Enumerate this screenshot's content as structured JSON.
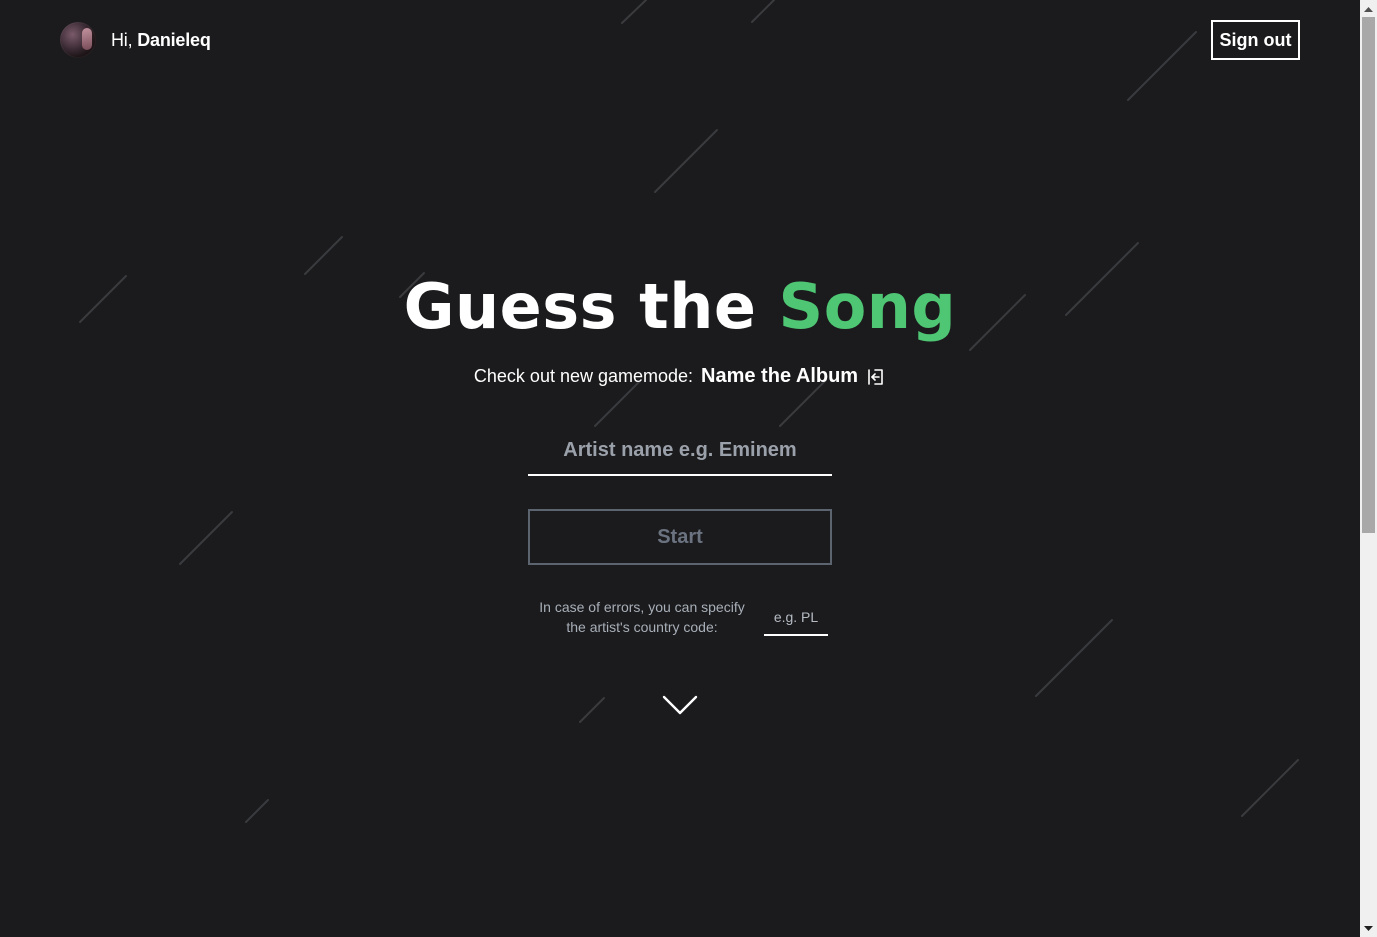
{
  "header": {
    "greeting_prefix": "Hi, ",
    "username": "Danieleq",
    "sign_out_label": "Sign out"
  },
  "hero": {
    "title_main": "Guess the ",
    "title_accent": "Song",
    "accent_color": "#4ec673",
    "subtitle_text": "Check out new gamemode:",
    "gamemode_link": "Name the Album",
    "gamemode_link_icon": "enter-icon"
  },
  "form": {
    "artist_placeholder": "Artist name e.g. Eminem",
    "artist_value": "",
    "start_label": "Start",
    "country_hint": "In case of errors, you can specify the artist's country code:",
    "country_placeholder": "e.g. PL",
    "country_value": ""
  },
  "scroll_icon": "chevron-down-icon",
  "colors": {
    "background": "#1b1b1d",
    "text": "#ffffff",
    "muted": "#a8afb8",
    "disabled_border": "#5c6470"
  }
}
